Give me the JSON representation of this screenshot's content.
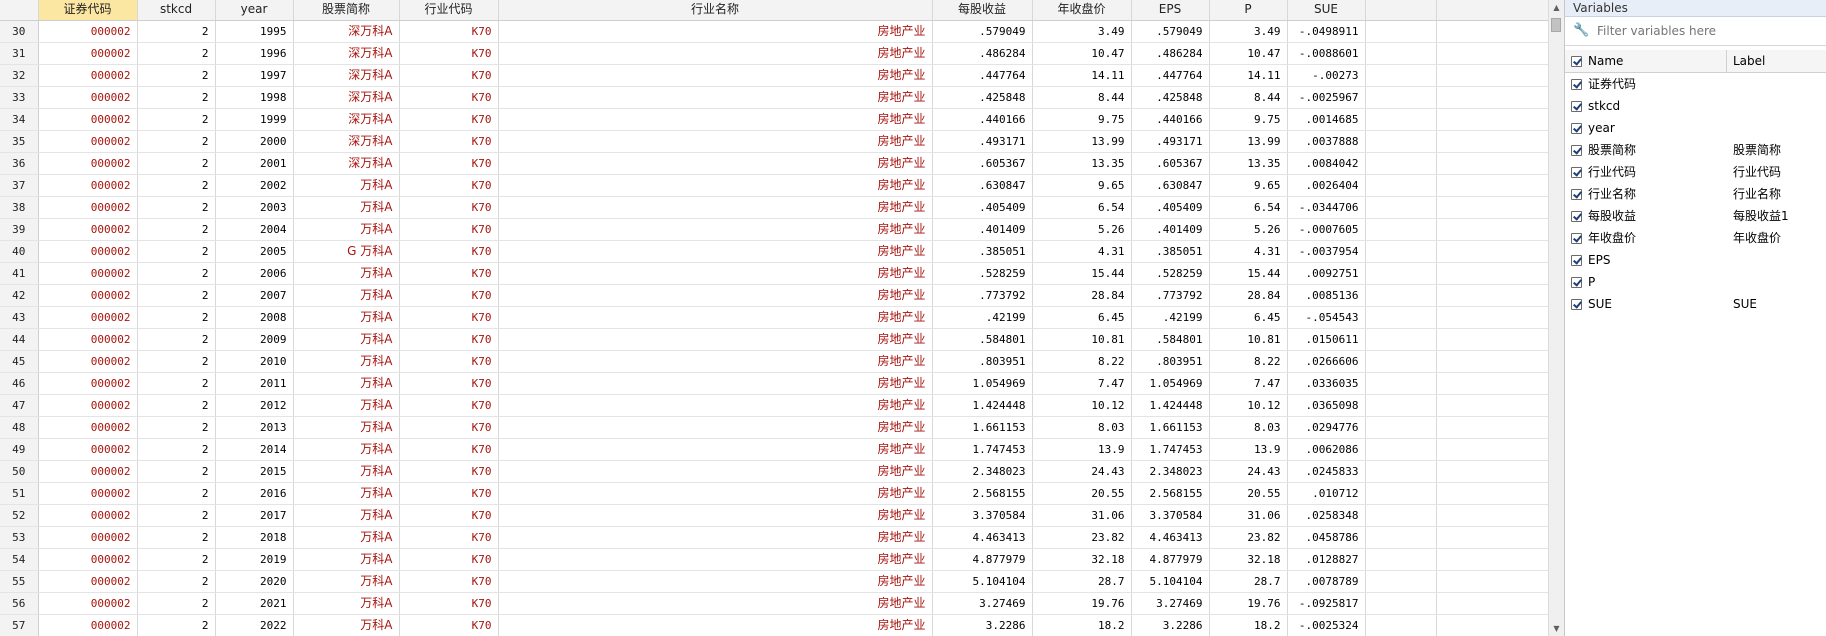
{
  "grid": {
    "row_numbers": [
      "30",
      "31",
      "32",
      "33",
      "34",
      "35",
      "36",
      "37",
      "38",
      "39",
      "40",
      "41",
      "42",
      "43",
      "44",
      "45",
      "46",
      "47",
      "48",
      "49",
      "50",
      "51",
      "52",
      "53",
      "54",
      "55",
      "56",
      "57"
    ],
    "columns": [
      "证券代码",
      "stkcd",
      "year",
      "股票简称",
      "行业代码",
      "行业名称",
      "每股收益",
      "年收盘价",
      "EPS",
      "P",
      "SUE"
    ],
    "rows": [
      [
        "000002",
        "2",
        "1995",
        "深万科A",
        "K70",
        "房地产业",
        ".579049",
        "3.49",
        ".579049",
        "3.49",
        "-.0498911"
      ],
      [
        "000002",
        "2",
        "1996",
        "深万科A",
        "K70",
        "房地产业",
        ".486284",
        "10.47",
        ".486284",
        "10.47",
        "-.0088601"
      ],
      [
        "000002",
        "2",
        "1997",
        "深万科A",
        "K70",
        "房地产业",
        ".447764",
        "14.11",
        ".447764",
        "14.11",
        "-.00273"
      ],
      [
        "000002",
        "2",
        "1998",
        "深万科A",
        "K70",
        "房地产业",
        ".425848",
        "8.44",
        ".425848",
        "8.44",
        "-.0025967"
      ],
      [
        "000002",
        "2",
        "1999",
        "深万科A",
        "K70",
        "房地产业",
        ".440166",
        "9.75",
        ".440166",
        "9.75",
        ".0014685"
      ],
      [
        "000002",
        "2",
        "2000",
        "深万科A",
        "K70",
        "房地产业",
        ".493171",
        "13.99",
        ".493171",
        "13.99",
        ".0037888"
      ],
      [
        "000002",
        "2",
        "2001",
        "深万科A",
        "K70",
        "房地产业",
        ".605367",
        "13.35",
        ".605367",
        "13.35",
        ".0084042"
      ],
      [
        "000002",
        "2",
        "2002",
        "万科A",
        "K70",
        "房地产业",
        ".630847",
        "9.65",
        ".630847",
        "9.65",
        ".0026404"
      ],
      [
        "000002",
        "2",
        "2003",
        "万科A",
        "K70",
        "房地产业",
        ".405409",
        "6.54",
        ".405409",
        "6.54",
        "-.0344706"
      ],
      [
        "000002",
        "2",
        "2004",
        "万科A",
        "K70",
        "房地产业",
        ".401409",
        "5.26",
        ".401409",
        "5.26",
        "-.0007605"
      ],
      [
        "000002",
        "2",
        "2005",
        "G 万科A",
        "K70",
        "房地产业",
        ".385051",
        "4.31",
        ".385051",
        "4.31",
        "-.0037954"
      ],
      [
        "000002",
        "2",
        "2006",
        "万科A",
        "K70",
        "房地产业",
        ".528259",
        "15.44",
        ".528259",
        "15.44",
        ".0092751"
      ],
      [
        "000002",
        "2",
        "2007",
        "万科A",
        "K70",
        "房地产业",
        ".773792",
        "28.84",
        ".773792",
        "28.84",
        ".0085136"
      ],
      [
        "000002",
        "2",
        "2008",
        "万科A",
        "K70",
        "房地产业",
        ".42199",
        "6.45",
        ".42199",
        "6.45",
        "-.054543"
      ],
      [
        "000002",
        "2",
        "2009",
        "万科A",
        "K70",
        "房地产业",
        ".584801",
        "10.81",
        ".584801",
        "10.81",
        ".0150611"
      ],
      [
        "000002",
        "2",
        "2010",
        "万科A",
        "K70",
        "房地产业",
        ".803951",
        "8.22",
        ".803951",
        "8.22",
        ".0266606"
      ],
      [
        "000002",
        "2",
        "2011",
        "万科A",
        "K70",
        "房地产业",
        "1.054969",
        "7.47",
        "1.054969",
        "7.47",
        ".0336035"
      ],
      [
        "000002",
        "2",
        "2012",
        "万科A",
        "K70",
        "房地产业",
        "1.424448",
        "10.12",
        "1.424448",
        "10.12",
        ".0365098"
      ],
      [
        "000002",
        "2",
        "2013",
        "万科A",
        "K70",
        "房地产业",
        "1.661153",
        "8.03",
        "1.661153",
        "8.03",
        ".0294776"
      ],
      [
        "000002",
        "2",
        "2014",
        "万科A",
        "K70",
        "房地产业",
        "1.747453",
        "13.9",
        "1.747453",
        "13.9",
        ".0062086"
      ],
      [
        "000002",
        "2",
        "2015",
        "万科A",
        "K70",
        "房地产业",
        "2.348023",
        "24.43",
        "2.348023",
        "24.43",
        ".0245833"
      ],
      [
        "000002",
        "2",
        "2016",
        "万科A",
        "K70",
        "房地产业",
        "2.568155",
        "20.55",
        "2.568155",
        "20.55",
        ".010712"
      ],
      [
        "000002",
        "2",
        "2017",
        "万科A",
        "K70",
        "房地产业",
        "3.370584",
        "31.06",
        "3.370584",
        "31.06",
        ".0258348"
      ],
      [
        "000002",
        "2",
        "2018",
        "万科A",
        "K70",
        "房地产业",
        "4.463413",
        "23.82",
        "4.463413",
        "23.82",
        ".0458786"
      ],
      [
        "000002",
        "2",
        "2019",
        "万科A",
        "K70",
        "房地产业",
        "4.877979",
        "32.18",
        "4.877979",
        "32.18",
        ".0128827"
      ],
      [
        "000002",
        "2",
        "2020",
        "万科A",
        "K70",
        "房地产业",
        "5.104104",
        "28.7",
        "5.104104",
        "28.7",
        ".0078789"
      ],
      [
        "000002",
        "2",
        "2021",
        "万科A",
        "K70",
        "房地产业",
        "3.27469",
        "19.76",
        "3.27469",
        "19.76",
        "-.0925817"
      ],
      [
        "000002",
        "2",
        "2022",
        "万科A",
        "K70",
        "房地产业",
        "3.2286",
        "18.2",
        "3.2286",
        "18.2",
        "-.0025324"
      ]
    ]
  },
  "variables_panel": {
    "title": "Variables",
    "filter_placeholder": "Filter variables here",
    "header_name": "Name",
    "header_label": "Label",
    "items": [
      {
        "name": "证券代码",
        "label": ""
      },
      {
        "name": "stkcd",
        "label": ""
      },
      {
        "name": "year",
        "label": ""
      },
      {
        "name": "股票简称",
        "label": "股票简称"
      },
      {
        "name": "行业代码",
        "label": "行业代码"
      },
      {
        "name": "行业名称",
        "label": "行业名称"
      },
      {
        "name": "每股收益",
        "label": "每股收益1"
      },
      {
        "name": "年收盘价",
        "label": "年收盘价"
      },
      {
        "name": "EPS",
        "label": ""
      },
      {
        "name": "P",
        "label": ""
      },
      {
        "name": "SUE",
        "label": "SUE"
      }
    ]
  },
  "colors": {
    "string_cell": "#a8140e",
    "selected_header": "#fbe6a2",
    "panel_title_bg": "#e8eef7"
  }
}
